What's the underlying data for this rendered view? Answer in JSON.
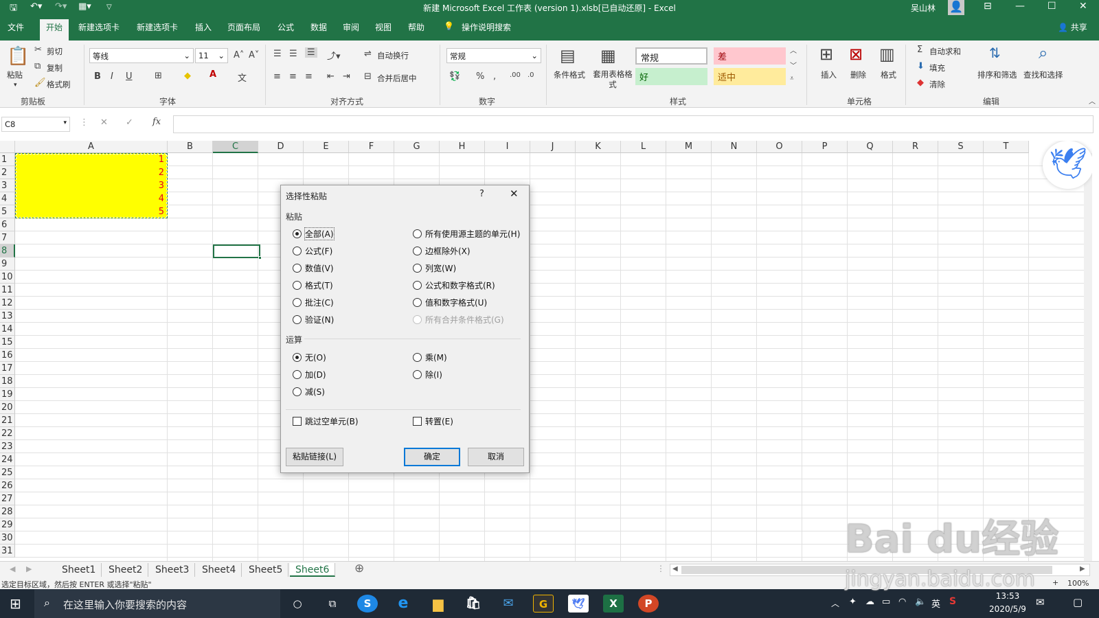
{
  "window": {
    "title": "新建 Microsoft Excel 工作表 (version 1).xlsb[已自动还原]  -  Excel",
    "user": "吴山林"
  },
  "ribbon_tabs": [
    "文件",
    "开始",
    "新建选项卡",
    "新建选项卡",
    "插入",
    "页面布局",
    "公式",
    "数据",
    "审阅",
    "视图",
    "帮助"
  ],
  "active_tab": "开始",
  "tell_me": "操作说明搜索",
  "share": "共享",
  "clipboard": {
    "paste": "粘贴",
    "cut": "剪切",
    "copy": "复制",
    "format_painter": "格式刷",
    "group": "剪贴板"
  },
  "font": {
    "name": "等线",
    "size": "11",
    "group": "字体"
  },
  "alignment": {
    "wrap": "自动换行",
    "merge": "合并后居中",
    "group": "对齐方式"
  },
  "number": {
    "format": "常规",
    "group": "数字"
  },
  "styles": {
    "conditional": "条件格式",
    "table": "套用表格格式",
    "normal": "常规",
    "bad": "差",
    "good": "好",
    "neutral": "适中",
    "group": "样式"
  },
  "cells": {
    "insert": "插入",
    "delete": "删除",
    "format": "格式",
    "group": "单元格"
  },
  "editing": {
    "autosum": "自动求和",
    "fill": "填充",
    "clear": "清除",
    "sort": "排序和筛选",
    "find": "查找和选择",
    "group": "编辑"
  },
  "formula_bar": {
    "name_box": "C8",
    "fx": "fx",
    "value": ""
  },
  "columns": [
    "A",
    "B",
    "C",
    "D",
    "E",
    "F",
    "G",
    "H",
    "I",
    "J",
    "K",
    "L",
    "M",
    "N",
    "O",
    "P",
    "Q",
    "R",
    "S",
    "T"
  ],
  "rows": [
    "1",
    "2",
    "3",
    "4",
    "5",
    "6",
    "7",
    "8",
    "9",
    "10",
    "11",
    "12",
    "13",
    "14",
    "15",
    "16",
    "17",
    "18",
    "19",
    "20",
    "21",
    "22",
    "23",
    "24",
    "25",
    "26",
    "27",
    "28",
    "29",
    "30",
    "31"
  ],
  "cell_values": {
    "A1": "1",
    "A2": "2",
    "A3": "3",
    "A4": "4",
    "A5": "5"
  },
  "colors": {
    "excel_green": "#217346",
    "fill_yellow": "#ffff00",
    "value_red": "#e8001c"
  },
  "dialog": {
    "title": "选择性粘贴",
    "help": "?",
    "paste_section": "粘贴",
    "paste_left": [
      "全部(A)",
      "公式(F)",
      "数值(V)",
      "格式(T)",
      "批注(C)",
      "验证(N)"
    ],
    "paste_right": [
      "所有使用源主题的单元(H)",
      "边框除外(X)",
      "列宽(W)",
      "公式和数字格式(R)",
      "值和数字格式(U)",
      "所有合并条件格式(G)"
    ],
    "operation_section": "运算",
    "op_left": [
      "无(O)",
      "加(D)",
      "减(S)"
    ],
    "op_right": [
      "乘(M)",
      "除(I)"
    ],
    "skip_blanks": "跳过空单元(B)",
    "transpose": "转置(E)",
    "paste_link": "粘贴链接(L)",
    "ok": "确定",
    "cancel": "取消"
  },
  "sheets": [
    "Sheet1",
    "Sheet2",
    "Sheet3",
    "Sheet4",
    "Sheet5",
    "Sheet6"
  ],
  "active_sheet": "Sheet6",
  "status_bar": {
    "message": "选定目标区域，然后按 ENTER 或选择\"粘贴\"",
    "zoom": "100%"
  },
  "taskbar": {
    "search": "在这里输入你要搜索的内容",
    "ime": "英",
    "time": "13:53",
    "date": "2020/5/9"
  },
  "watermark": {
    "brand": "Bai du经验",
    "url": "jingyan.baidu.com"
  }
}
